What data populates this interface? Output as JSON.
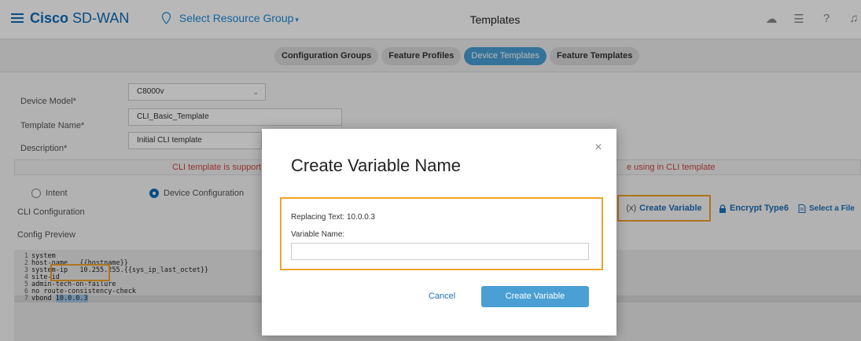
{
  "header": {
    "brand_bold": "Cisco",
    "brand_rest": "SD-WAN",
    "resource_group": "Select Resource Group",
    "title": "Templates"
  },
  "tabs": [
    {
      "label": "Configuration Groups"
    },
    {
      "label": "Feature Profiles"
    },
    {
      "label": "Device Templates",
      "active": true
    },
    {
      "label": "Feature Templates"
    }
  ],
  "form": {
    "device_model_label": "Device Model*",
    "device_model_value": "C8000v",
    "template_name_label": "Template Name*",
    "template_name_value": "CLI_Basic_Template",
    "description_label": "Description*",
    "description_value": "Initial CLI template"
  },
  "info": {
    "left": "CLI template is support",
    "right": "e using in CLI template"
  },
  "radios": {
    "intent": "Intent",
    "device_config": "Device Configuration"
  },
  "cli_label": "CLI Configuration",
  "preview_label": "Config Preview",
  "toolbar": {
    "create_var_prefix": "(x)",
    "create_var": "Create Variable",
    "encrypt": "Encrypt Type6",
    "select_file": "Select a File"
  },
  "code": [
    {
      "n": "1",
      "text": "system"
    },
    {
      "n": "2",
      "text": "host-name   {{hostname}}"
    },
    {
      "n": "3",
      "text": "system-ip   10.255.255.{{sys_ip_last_octet}}"
    },
    {
      "n": "4",
      "text": "site-id"
    },
    {
      "n": "5",
      "text": "admin-tech-on-failure"
    },
    {
      "n": "6",
      "text": "no route-consistency-check"
    },
    {
      "n": "7",
      "text_prefix": "vbond ",
      "text_sel": "10.0.0.3"
    }
  ],
  "modal": {
    "title": "Create Variable Name",
    "replacing": "Replacing Text: 10.0.0.3",
    "var_label": "Variable Name:",
    "var_value": "",
    "cancel": "Cancel",
    "confirm": "Create Variable"
  },
  "colors": {
    "brand": "#0d6bb8",
    "accent": "#4a9fd5",
    "highlight": "#f1a22a"
  }
}
